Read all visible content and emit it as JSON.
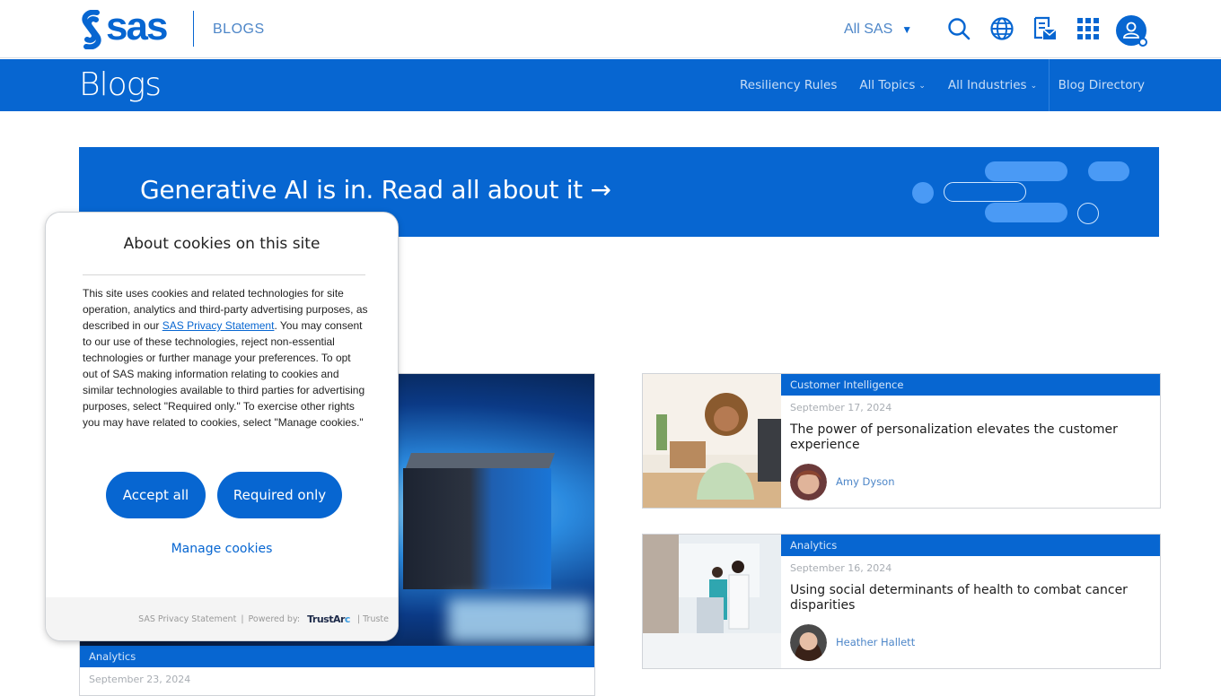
{
  "header": {
    "logo_text": "sas",
    "section_label": "BLOGS",
    "site_selector": "All SAS",
    "icons": [
      "search-icon",
      "globe-icon",
      "newsletter-icon",
      "apps-grid-icon",
      "user-account-icon"
    ]
  },
  "navbar": {
    "title": "Blogs",
    "links": [
      {
        "label": "Resiliency Rules",
        "dropdown": false
      },
      {
        "label": "All Topics",
        "dropdown": true
      },
      {
        "label": "All Industries",
        "dropdown": true
      },
      {
        "label": "Blog Directory",
        "dropdown": false
      }
    ]
  },
  "promo": {
    "text": "Generative AI is in. Read all about it",
    "arrow": "→"
  },
  "featured": {
    "category": "Analytics",
    "date": "September 23, 2024"
  },
  "posts": [
    {
      "category": "Customer Intelligence",
      "date": "September 17, 2024",
      "title": "The power of personalization elevates the customer experience",
      "author": "Amy Dyson"
    },
    {
      "category": "Analytics",
      "date": "September 16, 2024",
      "title": "Using social determinants of health to combat cancer disparities",
      "author": "Heather Hallett"
    }
  ],
  "cookie": {
    "title": "About cookies on this site",
    "text_before": "This site uses cookies and related technologies for site operation, analytics and third-party advertising purposes, as described in our ",
    "link_text": "SAS Privacy Statement",
    "text_after": ". You may consent to our use of these technologies, reject non-essential technologies or further manage your preferences. To opt out of SAS making information relating to cookies and similar technologies available to third parties for advertising purposes, select \"Required only.\" To exercise other rights you may have related to cookies, select \"Manage cookies.\"",
    "accept_label": "Accept all",
    "required_label": "Required only",
    "manage_label": "Manage cookies",
    "footer": {
      "privacy_link": "SAS Privacy Statement",
      "separator": "|",
      "powered_by": "Powered by:",
      "brand_main": "TrustAr",
      "brand_accent": "c",
      "truste": "| Truste"
    }
  },
  "colors": {
    "brand_blue": "#0766d1",
    "link_blue": "#4d86c8",
    "date_gray": "#a8adb3"
  }
}
